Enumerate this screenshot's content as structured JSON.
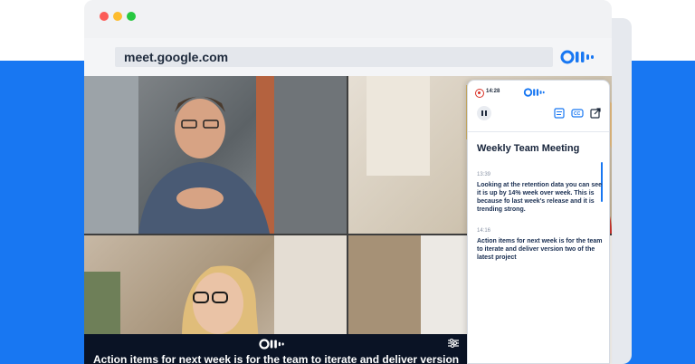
{
  "browser": {
    "url": "meet.google.com"
  },
  "extension": {
    "logo_name": "otter-logo"
  },
  "caption": {
    "text": "Action items for next week is for the team to iterate and deliver version"
  },
  "panel": {
    "recording_time": "14:28",
    "meeting_title": "Weekly Team Meeting",
    "entries": [
      {
        "time": "13:39",
        "text": "Looking at the retention data you can see it is up by 14% week over week. This is because fo last week's release and it is trending strong."
      },
      {
        "time": "14:16",
        "text": "Action items for next week is for the team to iterate and deliver version two of the latest project"
      }
    ]
  },
  "colors": {
    "brand_blue": "#1877f2",
    "navy": "#0a1325",
    "record_red": "#d93025"
  }
}
